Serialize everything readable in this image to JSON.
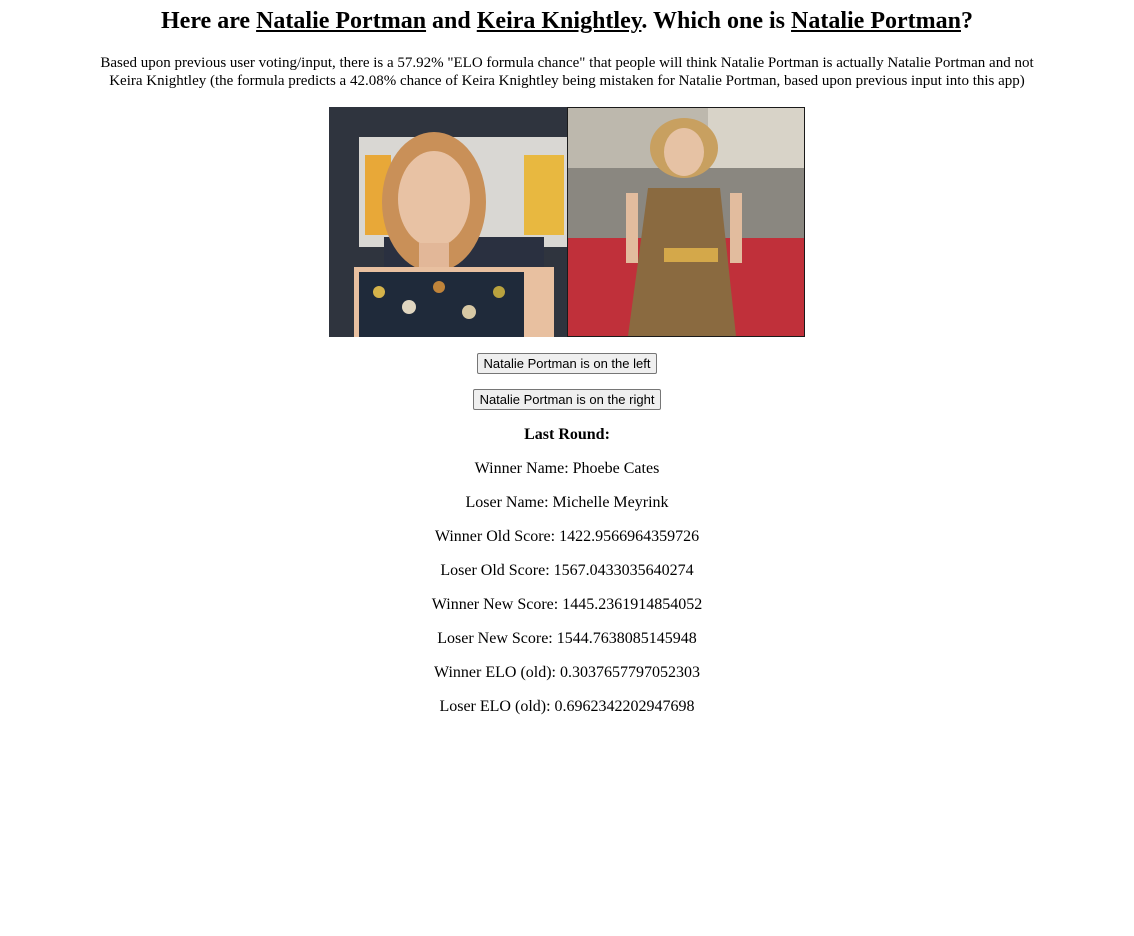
{
  "title": {
    "prefix": "Here are ",
    "name_a": "Natalie Portman",
    "and": " and ",
    "name_b": "Keira Knightley",
    "question": ". Which one is ",
    "name_target": "Natalie Portman",
    "end": "?"
  },
  "intro": "Based upon previous user voting/input, there is a 57.92% \"ELO formula chance\" that people will think Natalie Portman is actually Natalie Portman and not Keira Knightley (the formula predicts a 42.08% chance of Keira Knightley being mistaken for Natalie Portman, based upon previous input into this app)",
  "buttons": {
    "left": "Natalie Portman is on the left",
    "right": "Natalie Portman is on the right"
  },
  "last_round": {
    "heading": "Last Round:",
    "winner_name": "Winner Name: Phoebe Cates",
    "loser_name": "Loser Name: Michelle Meyrink",
    "winner_old_score": "Winner Old Score: 1422.9566964359726",
    "loser_old_score": "Loser Old Score: 1567.0433035640274",
    "winner_new_score": "Winner New Score: 1445.2361914854052",
    "loser_new_score": "Loser New Score: 1544.7638085145948",
    "winner_elo_old": "Winner ELO (old): 0.3037657797052303",
    "loser_elo_old": "Loser ELO (old): 0.6962342202947698"
  },
  "colors": {
    "background": "#ffffff",
    "text": "#000000",
    "button_bg": "#efefef",
    "button_border": "#767676"
  }
}
